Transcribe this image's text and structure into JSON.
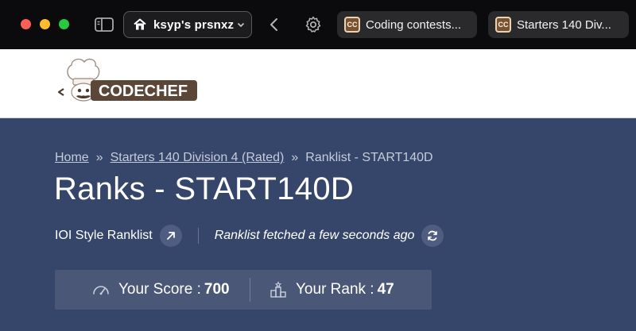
{
  "browser": {
    "profile_name": "ksyp's prsnxz",
    "tabs": [
      {
        "favicon": "CC",
        "title": "Coding contests..."
      },
      {
        "favicon": "CC",
        "title": "Starters 140 Div..."
      }
    ],
    "icons": [
      "sidebar-icon",
      "house-icon",
      "chevron-down-icon",
      "back-arrow-icon",
      "gear-icon"
    ]
  },
  "site": {
    "logo_text": "CODECHEF",
    "brand_color": "#5b4638",
    "header_bg": "#ffffff",
    "main_bg": "#36466a"
  },
  "breadcrumb": {
    "home": "Home",
    "sep1": "»",
    "contest": "Starters 140 Division 4 (Rated)",
    "sep2": "»",
    "current": "Ranklist - START140D"
  },
  "page": {
    "title": "Ranks - START140D",
    "ranklist_style": "IOI Style Ranklist",
    "fetched_status": "Ranklist fetched a few seconds ago"
  },
  "stats": {
    "score_label": "Your Score :",
    "score_value": "700",
    "rank_label": "Your Rank :",
    "rank_value": "47"
  }
}
